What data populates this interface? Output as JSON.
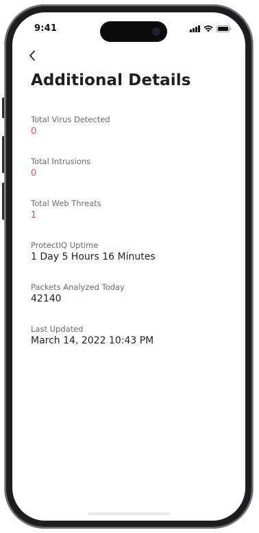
{
  "status_bar": {
    "time": "9:41",
    "icons": [
      "cellular-signal-icon",
      "wifi-icon",
      "battery-icon"
    ]
  },
  "nav": {
    "back_icon": "chevron-left-icon"
  },
  "page": {
    "title": "Additional Details"
  },
  "details": [
    {
      "label": "Total Virus Detected",
      "value": "0"
    },
    {
      "label": "Total Intrusions",
      "value": "0"
    },
    {
      "label": "Total Web Threats",
      "value": "1"
    },
    {
      "label": "ProtectIQ Uptime",
      "value": "1 Day 5 Hours 16 Minutes"
    },
    {
      "label": "Packets Analyzed Today",
      "value": "42140"
    },
    {
      "label": "Last Updated",
      "value": "March 14, 2022 10:43 PM"
    }
  ],
  "colors": {
    "alert_value": "#d9506b",
    "title_text": "#1f1f1f",
    "label_text": "#6c6c6c",
    "phone_frame": "#1d1d1f"
  }
}
